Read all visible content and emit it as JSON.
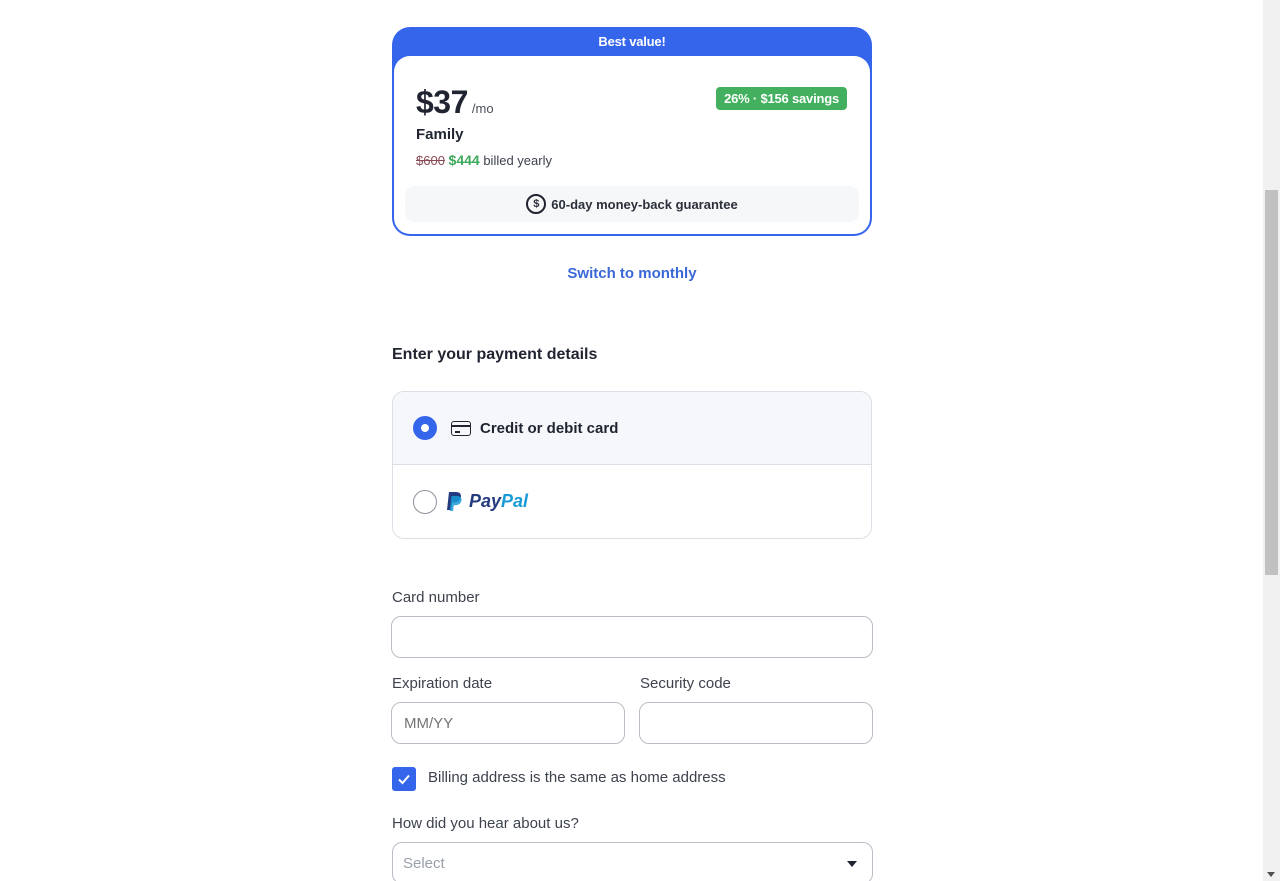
{
  "plan": {
    "ribbon": "Best value!",
    "price": "$37",
    "per": "/mo",
    "savings": "26% · $156 savings",
    "name": "Family",
    "old_price": "$600",
    "new_price": "$444",
    "billing": "billed yearly",
    "guarantee": "60-day money-back guarantee"
  },
  "switch_link": "Switch to monthly",
  "payment": {
    "title": "Enter your payment details",
    "options": [
      {
        "label": "Credit or debit card",
        "selected": true
      },
      {
        "label": "PayPal",
        "selected": false
      }
    ],
    "paypal_pay": "Pay",
    "paypal_pal": "Pal"
  },
  "form": {
    "card_number_label": "Card number",
    "card_number_value": "",
    "expiration_label": "Expiration date",
    "expiration_placeholder": "MM/YY",
    "security_label": "Security code",
    "security_value": "",
    "billing_same_label": "Billing address is the same as home address",
    "billing_same_checked": true,
    "hear_label": "How did you hear about us?",
    "hear_selected": "Select"
  },
  "colors": {
    "accent": "#3565ea",
    "savings_green": "#43b05f"
  }
}
